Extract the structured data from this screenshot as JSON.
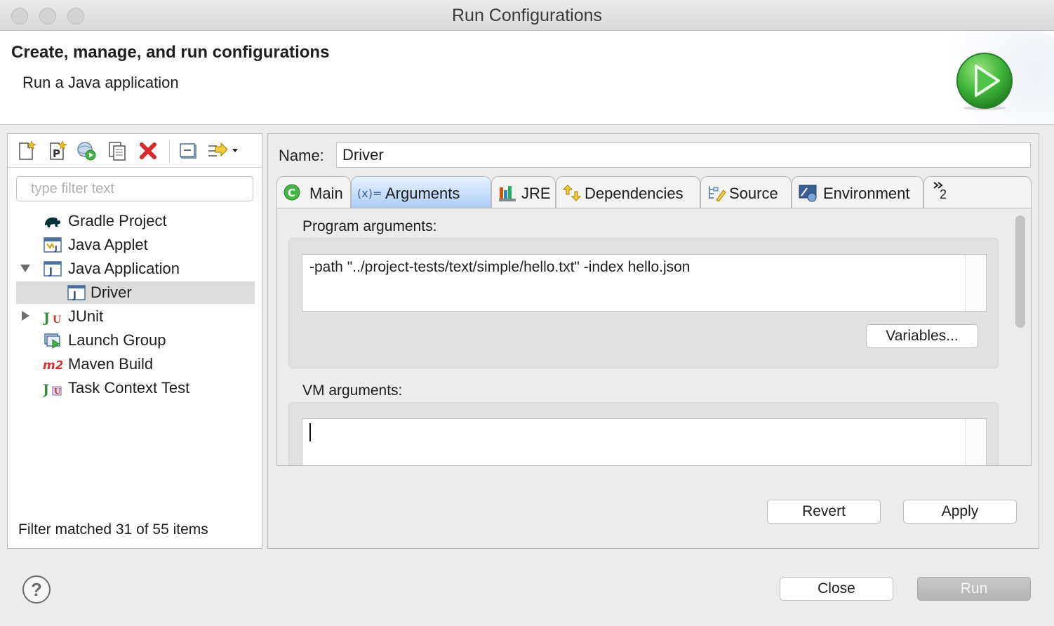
{
  "window": {
    "title": "Run Configurations"
  },
  "header": {
    "title": "Create, manage, and run configurations",
    "subtitle": "Run a Java application"
  },
  "toolbar": {
    "icons": [
      "new-configuration-icon",
      "new-prototype-icon",
      "export-icon",
      "duplicate-icon",
      "delete-icon",
      "collapse-all-icon",
      "filter-menu-icon"
    ]
  },
  "filter": {
    "placeholder": "type filter text",
    "value": ""
  },
  "tree": {
    "items": [
      {
        "label": "Gradle Project"
      },
      {
        "label": "Java Applet"
      },
      {
        "label": "Java Application"
      },
      {
        "label": "Driver"
      },
      {
        "label": "JUnit"
      },
      {
        "label": "Launch Group"
      },
      {
        "label": "Maven Build"
      },
      {
        "label": "Task Context Test"
      }
    ],
    "status": "Filter matched 31 of 55 items"
  },
  "config": {
    "name_label": "Name:",
    "name_value": "Driver"
  },
  "tabs": [
    {
      "label": "Main"
    },
    {
      "label": "Arguments"
    },
    {
      "label": "JRE"
    },
    {
      "label": "Dependencies"
    },
    {
      "label": "Source"
    },
    {
      "label": "Environment"
    },
    {
      "label": "2"
    }
  ],
  "arguments": {
    "program_label": "Program arguments:",
    "program_value": "-path \"../project-tests/text/simple/hello.txt\" -index hello.json",
    "variables_label": "Variables...",
    "vm_label": "VM arguments:",
    "vm_value": ""
  },
  "buttons": {
    "revert": "Revert",
    "apply": "Apply",
    "close": "Close",
    "run": "Run",
    "help": "?"
  },
  "colors": {
    "active_tab": "#a9cdf6",
    "selection": "#dcdcdc",
    "run_green": "#3fb53a"
  }
}
